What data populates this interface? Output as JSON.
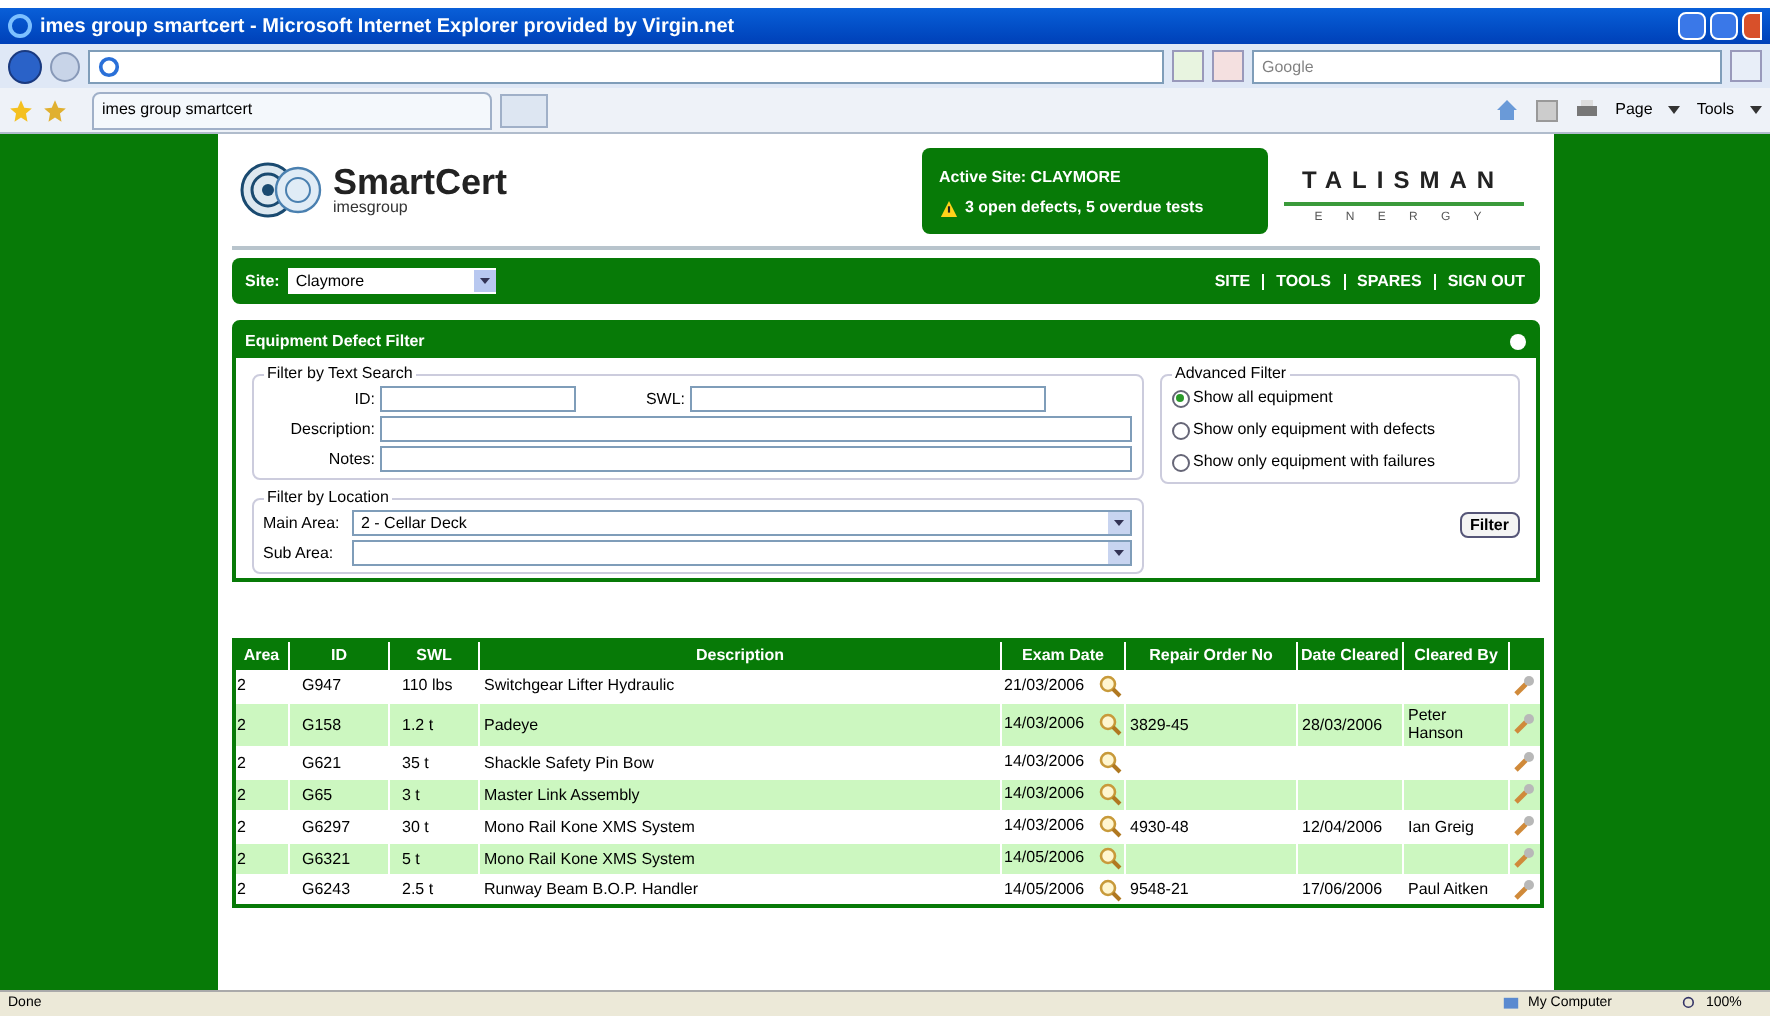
{
  "window": {
    "title": "imes group smartcert - Microsoft Internet Explorer provided by Virgin.net"
  },
  "browser": {
    "search_placeholder": "Google",
    "tab": "imes group smartcert",
    "commands": [
      "Page",
      "Tools"
    ]
  },
  "header": {
    "logo": {
      "name": "SmartCert",
      "sub": "imesgroup"
    },
    "alert": {
      "site": "Active Site: CLAYMORE",
      "message": "3 open defects, 5 overdue tests"
    },
    "partner": {
      "name": "TALISMAN",
      "sub": "E N E R G Y"
    }
  },
  "site_bar": {
    "label": "Site:",
    "value": "Claymore",
    "links": [
      "SITE",
      "TOOLS",
      "SPARES",
      "SIGN OUT"
    ]
  },
  "filter": {
    "title": "Equipment Defect Filter",
    "text_search": {
      "legend": "Filter by Text Search",
      "id_label": "ID:",
      "swl_label": "SWL:",
      "description_label": "Description:",
      "notes_label": "Notes:"
    },
    "location": {
      "legend": "Filter by Location",
      "main_label": "Main Area:",
      "main_value": "2 - Cellar Deck",
      "sub_label": "Sub Area:"
    },
    "advanced": {
      "legend": "Advanced Filter",
      "options": [
        {
          "label": "Show all equipment",
          "selected": true
        },
        {
          "label": "Show only equipment with defects",
          "selected": false
        },
        {
          "label": "Show only equipment with failures",
          "selected": false
        }
      ]
    },
    "button": "Filter"
  },
  "table": {
    "columns": [
      "Area",
      "ID",
      "SWL",
      "Description",
      "Exam Date",
      "Repair Order No",
      "Date Cleared",
      "Cleared By"
    ],
    "rows": [
      [
        "2",
        "G947",
        "110 lbs",
        "Switchgear Lifter Hydraulic",
        "21/03/2006",
        "",
        "",
        ""
      ],
      [
        "2",
        "G158",
        "1.2 t",
        "Padeye",
        "14/03/2006",
        "3829-45",
        "28/03/2006",
        "Peter Hanson"
      ],
      [
        "2",
        "G621",
        "35 t",
        "Shackle Safety Pin Bow",
        "14/03/2006",
        "",
        "",
        ""
      ],
      [
        "2",
        "G65",
        "3 t",
        "Master Link Assembly",
        "14/03/2006",
        "",
        "",
        ""
      ],
      [
        "2",
        "G6297",
        "30 t",
        "Mono Rail Kone XMS System",
        "14/03/2006",
        "4930-48",
        "12/04/2006",
        "Ian Greig"
      ],
      [
        "2",
        "G6321",
        "5 t",
        "Mono Rail Kone XMS System",
        "14/05/2006",
        "",
        "",
        ""
      ],
      [
        "2",
        "G6243",
        "2.5 t",
        "Runway Beam B.O.P. Handler",
        "14/05/2006",
        "9548-21",
        "17/06/2006",
        "Paul Aitken"
      ]
    ]
  },
  "status_bar": {
    "text": "Done",
    "zone": "My Computer",
    "zoom": "100%"
  }
}
